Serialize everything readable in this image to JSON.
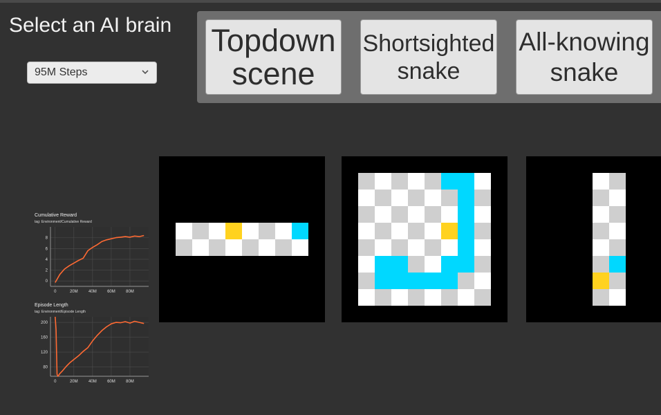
{
  "header": {
    "title": "Select an AI brain"
  },
  "brain_select": {
    "value": "95M Steps"
  },
  "view_buttons": [
    {
      "lines": [
        "Topdown",
        "scene"
      ]
    },
    {
      "lines": [
        "Shortsighted",
        "snake"
      ]
    },
    {
      "lines": [
        "All-knowing",
        "snake"
      ]
    }
  ],
  "colors": {
    "snake": "#00d8ff",
    "food": "#ffd21f",
    "tile_light": "#ffffff",
    "tile_dark": "#cfcfcf",
    "plot_line": "#ff6a33"
  },
  "chart_data": [
    {
      "type": "line",
      "title": "Cumulative Reward",
      "subtitle": "tag: Environment/Cumulative Reward",
      "x_tick_labels": [
        "0",
        "20M",
        "40M",
        "60M",
        "80M"
      ],
      "y_tick_labels": [
        "0",
        "2",
        "4",
        "6",
        "8"
      ],
      "ylim": [
        -1,
        10
      ],
      "xlim": [
        -5,
        100
      ],
      "series": [
        {
          "x": [
            0,
            2,
            5,
            10,
            15,
            20,
            25,
            30,
            35,
            40,
            45,
            50,
            55,
            60,
            65,
            70,
            75,
            80,
            85,
            90,
            95
          ],
          "values": [
            -0.3,
            0.3,
            1.2,
            2.2,
            2.8,
            3.3,
            3.8,
            4.2,
            5.6,
            6.2,
            6.7,
            7.3,
            7.6,
            7.8,
            8.0,
            8.1,
            8.2,
            8.1,
            8.3,
            8.2,
            8.4
          ]
        }
      ],
      "grid": true
    },
    {
      "type": "line",
      "title": "Episode Length",
      "subtitle": "tag: Environment/Episode Length",
      "x_tick_labels": [
        "0",
        "20M",
        "40M",
        "60M",
        "80M"
      ],
      "y_tick_labels": [
        "80",
        "120",
        "160",
        "200"
      ],
      "ylim": [
        55,
        215
      ],
      "xlim": [
        -5,
        100
      ],
      "series": [
        {
          "x": [
            0,
            1,
            2,
            3,
            5,
            8,
            12,
            16,
            20,
            25,
            30,
            35,
            40,
            45,
            50,
            55,
            60,
            65,
            70,
            75,
            80,
            85,
            90,
            95
          ],
          "values": [
            215,
            180,
            60,
            55,
            62,
            70,
            82,
            92,
            100,
            110,
            122,
            132,
            150,
            165,
            178,
            188,
            196,
            200,
            199,
            202,
            198,
            203,
            200,
            197
          ]
        }
      ],
      "grid": true
    }
  ]
}
